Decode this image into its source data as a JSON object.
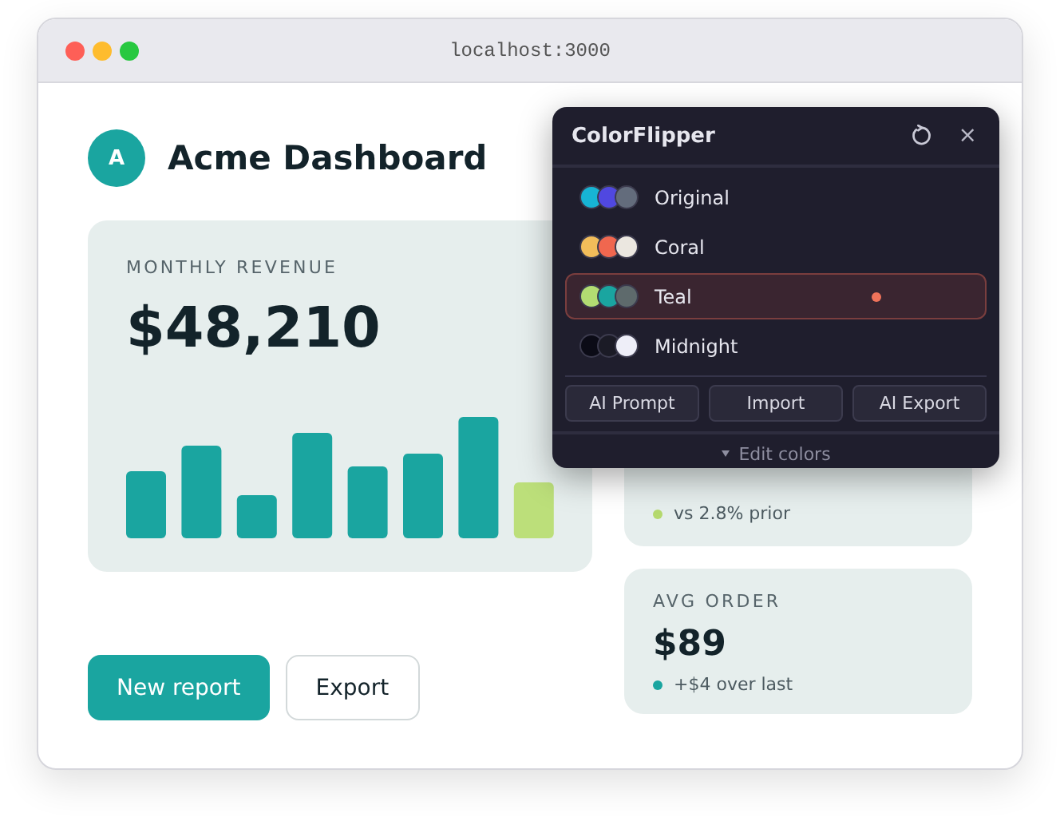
{
  "browser": {
    "url": "localhost:3000"
  },
  "header": {
    "avatar": "A",
    "title": "Acme Dashboard"
  },
  "revenue_card": {
    "label": "MONTHLY REVENUE",
    "value": "$48,210"
  },
  "stats": [
    {
      "note": "vs 2.8% prior",
      "color": "#b5d96e"
    },
    {
      "label": "AVG ORDER",
      "value": "$89",
      "note": "+$4 over last",
      "color": "#1aa5a0"
    }
  ],
  "actions": [
    {
      "label": "New report",
      "kind": "primary"
    },
    {
      "label": "Export",
      "kind": "secondary"
    }
  ],
  "popup": {
    "title": "ColorFlipper",
    "close": "×",
    "presets": [
      {
        "name": "Original",
        "selected": false,
        "swatches": [
          {
            "color": "#17b4d4"
          },
          {
            "color": "#5048e0"
          },
          {
            "color": "#636c7c"
          }
        ]
      },
      {
        "name": "Coral",
        "selected": false,
        "swatches": [
          {
            "color": "#f2bd5a"
          },
          {
            "color": "#f0674f"
          },
          {
            "color": "#ebe7e0"
          }
        ]
      },
      {
        "name": "Teal",
        "selected": true,
        "swatches": [
          {
            "color": "#b2dc72"
          },
          {
            "color": "#1aa5a0"
          },
          {
            "color": "#5e6a6c"
          }
        ]
      },
      {
        "name": "Midnight",
        "selected": false,
        "swatches": [
          {
            "color": "#0b0b16"
          },
          {
            "color": "#1b1b26"
          },
          {
            "color": "#eeeef8"
          }
        ]
      }
    ],
    "buttons": [
      "AI Prompt",
      "Import",
      "AI Export"
    ],
    "footer": "Edit colors"
  }
}
